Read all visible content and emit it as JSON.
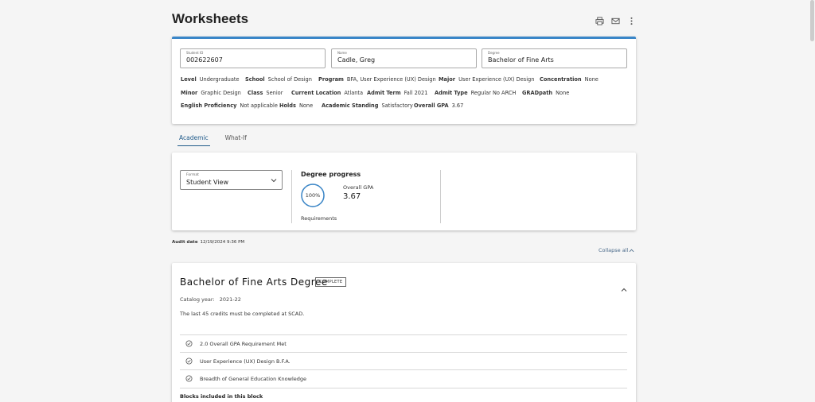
{
  "header": {
    "title": "Worksheets",
    "icons": [
      "print-icon",
      "email-icon",
      "more-vert-icon"
    ]
  },
  "student": {
    "id_label": "Student ID",
    "id_value": "002622607",
    "name_label": "Name",
    "name_value": "Cadle, Greg",
    "degree_label": "Degree",
    "degree_value": "Bachelor of Fine Arts",
    "info": [
      {
        "label": "Level",
        "value": "Undergraduate"
      },
      {
        "label": "School",
        "value": "School of Design"
      },
      {
        "label": "Program",
        "value": "BFA, User Experience (UX) Design"
      },
      {
        "label": "Major",
        "value": "User Experience (UX) Design"
      },
      {
        "label": "Concentration",
        "value": "None"
      },
      {
        "label": "Minor",
        "value": "Graphic Design"
      },
      {
        "label": "Class",
        "value": "Senior"
      },
      {
        "label": "Current Location",
        "value": "Atlanta"
      },
      {
        "label": "Admit Term",
        "value": "Fall 2021"
      },
      {
        "label": "Admit Type",
        "value": "Regular No ARCH"
      },
      {
        "label": "GRADpath",
        "value": "None"
      },
      {
        "label": "English Proficiency",
        "value": "Not applicable"
      },
      {
        "label": "Holds",
        "value": "None"
      },
      {
        "label": "Academic Standing",
        "value": "Satisfactory"
      },
      {
        "label": "Overall GPA",
        "value": "3.67"
      }
    ]
  },
  "tabs": [
    {
      "label": "Academic",
      "active": true
    },
    {
      "label": "What-If",
      "active": false
    }
  ],
  "progress": {
    "format_label": "Format",
    "format_value": "Student View",
    "title": "Degree progress",
    "percent": 100,
    "percent_text": "100%",
    "requirements_label": "Requirements",
    "gpa_label": "Overall GPA",
    "gpa_value": "3.67",
    "ring_color": "#3a86c8"
  },
  "audit": {
    "label": "Audit date",
    "value": "12/19/2024 9:36 PM",
    "collapse_label": "Collapse all"
  },
  "degree_block": {
    "title": "Bachelor of Fine Arts Degree",
    "badge": "COMPLETE",
    "catalog_label": "Catalog year:",
    "catalog_value": "2021-22",
    "note": "The last 45 credits must be completed at SCAD.",
    "requirements": [
      "2.0 Overall GPA Requirement Met",
      "User Experience (UX) Design B.F.A.",
      "Breadth of General Education Knowledge"
    ],
    "blocks_label": "Blocks included in this block"
  },
  "colors": {
    "accent": "#3a86c8",
    "link": "#4a6a8a"
  }
}
